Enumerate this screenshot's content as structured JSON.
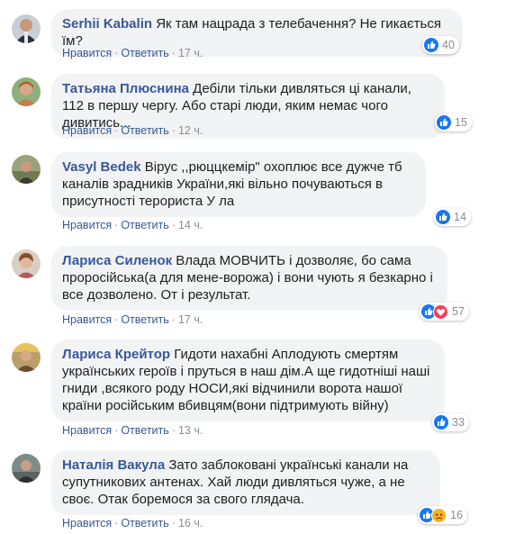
{
  "actions": {
    "like": "Нравится",
    "reply": "Ответить",
    "dot": "·"
  },
  "colors": {
    "author": "#385898",
    "bubble": "#f2f3f5",
    "like": "#1877f2",
    "love": "#f33e58",
    "sad": "#f7b125"
  },
  "comments": [
    {
      "author": "Serhii Kabalin",
      "text": "Як там нацрада з телебачення? Не гикається їм?",
      "time": "17 ч.",
      "reactions": [
        "like-icon"
      ],
      "count": "40"
    },
    {
      "author": "Татьяна Плюснина",
      "text": "Дебіли тільки дивляться ці канали, 112 в першу чергу. Або старі люди, яким немає чого дивитись...",
      "time": "12 ч.",
      "reactions": [
        "like-icon"
      ],
      "count": "15"
    },
    {
      "author": "Vasyl Bedek",
      "text": "Вірус ,,рюццкемір\" охоплює все дужче тб каналів зрадників України,які вільно почуваються в присутності терориста У    ла",
      "time": "14 ч.",
      "reactions": [
        "like-icon"
      ],
      "count": "14"
    },
    {
      "author": "Лариса Силенок",
      "text": "Влада МОВЧИТЬ і дозволяє, бо сама проросійська(а для мене-ворожа) і вони чують я безкарно і все дозволено. От і результат.",
      "time": "17 ч.",
      "reactions": [
        "like-icon",
        "love-icon"
      ],
      "count": "57"
    },
    {
      "author": "Лариса Крейтор",
      "text": "Гидоти нахабні Аплодують смертям українських героїв і пруться в наш дім.А ще гидотніші наші гниди ,всякого роду НОСИ,які відчинили ворота нашої країни російським вбивцям(вони підтримують війну)",
      "time": "13 ч.",
      "reactions": [
        "like-icon"
      ],
      "count": "33"
    },
    {
      "author": "Наталія Вакула",
      "text": "Зато заблоковані українські канали на супутникових антенах. Хай люди дивляться чуже, а не своє. Отак боремося за свого глядача.",
      "time": "16 ч.",
      "reactions": [
        "like-icon",
        "sad-icon"
      ],
      "count": "16"
    }
  ]
}
